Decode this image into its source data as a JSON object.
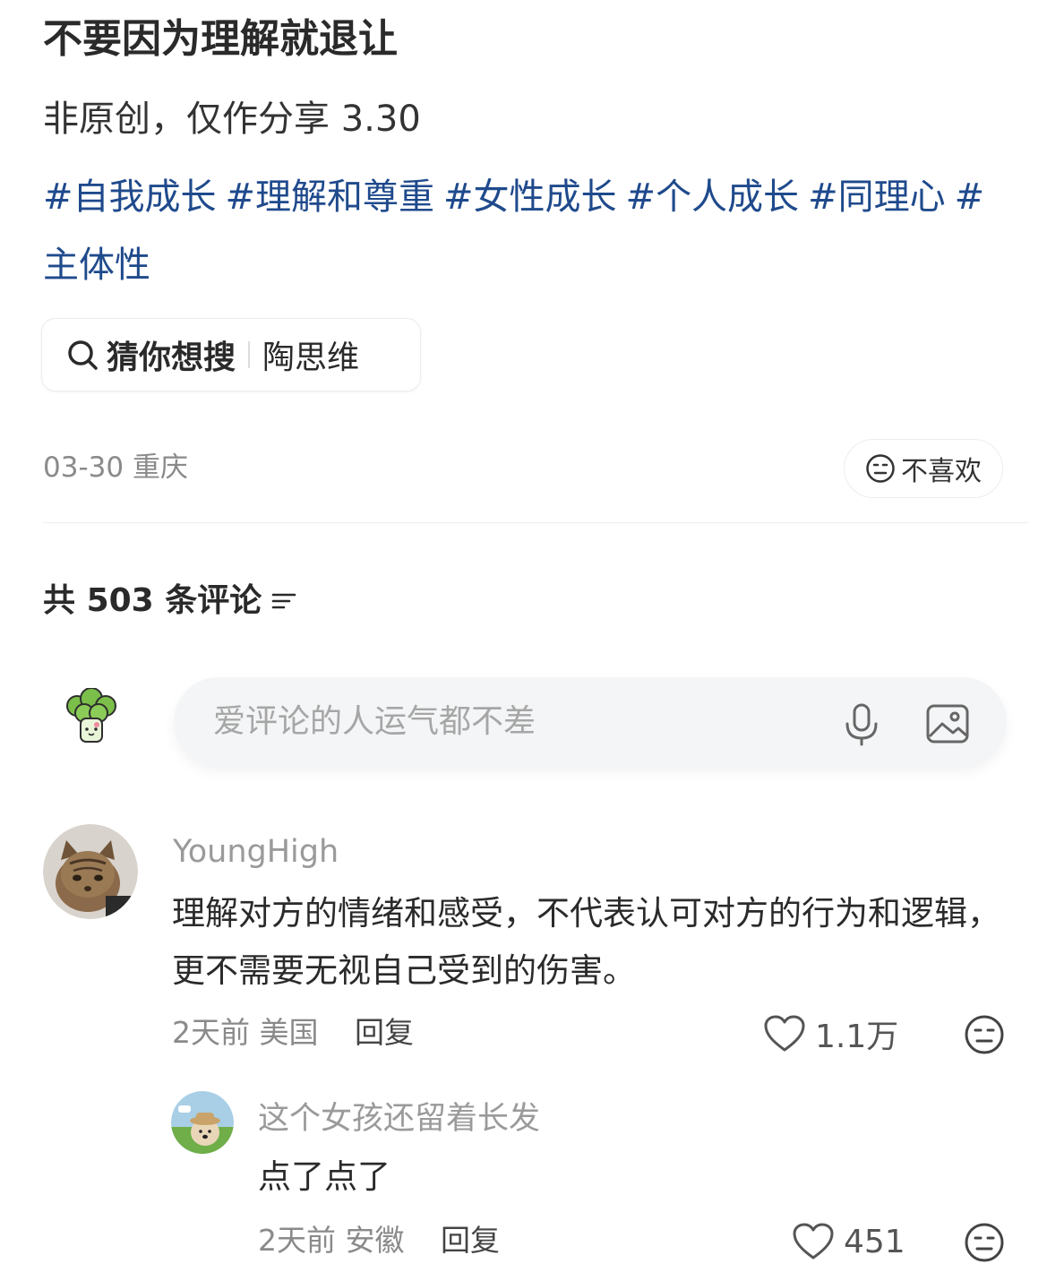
{
  "post": {
    "title": "不要因为理解就退让",
    "description": "非原创，仅作分享 3.30",
    "tags": [
      "#自我成长",
      "#理解和尊重",
      "#女性成长",
      "#个人成长",
      "#同理心",
      "#主体性"
    ],
    "search_suggestion": {
      "label": "猜你想搜",
      "term": "陶思维"
    },
    "date": "03-30",
    "location": "重庆",
    "dislike_label": "不喜欢"
  },
  "comments_section": {
    "count_prefix": "共",
    "count": "503",
    "count_suffix": "条评论",
    "input_placeholder": "爱评论的人运气都不差"
  },
  "comments": [
    {
      "username": "YoungHigh",
      "text": "理解对方的情绪和感受，不代表认可对方的行为和逻辑，更不需要无视自己受到的伤害。",
      "time": "2天前",
      "location": "美国",
      "reply_label": "回复",
      "likes": "1.1万"
    },
    {
      "username": "这个女孩还留着长发",
      "text": "点了点了",
      "time": "2天前",
      "location": "安徽",
      "reply_label": "回复",
      "likes": "451"
    }
  ],
  "colors": {
    "tag": "#1f4a8c",
    "muted": "#8a8a8a",
    "input_bg": "#f4f5f6"
  },
  "icons": [
    "search-icon",
    "neutral-face-icon",
    "sort-icon",
    "microphone-icon",
    "image-icon",
    "heart-icon"
  ]
}
